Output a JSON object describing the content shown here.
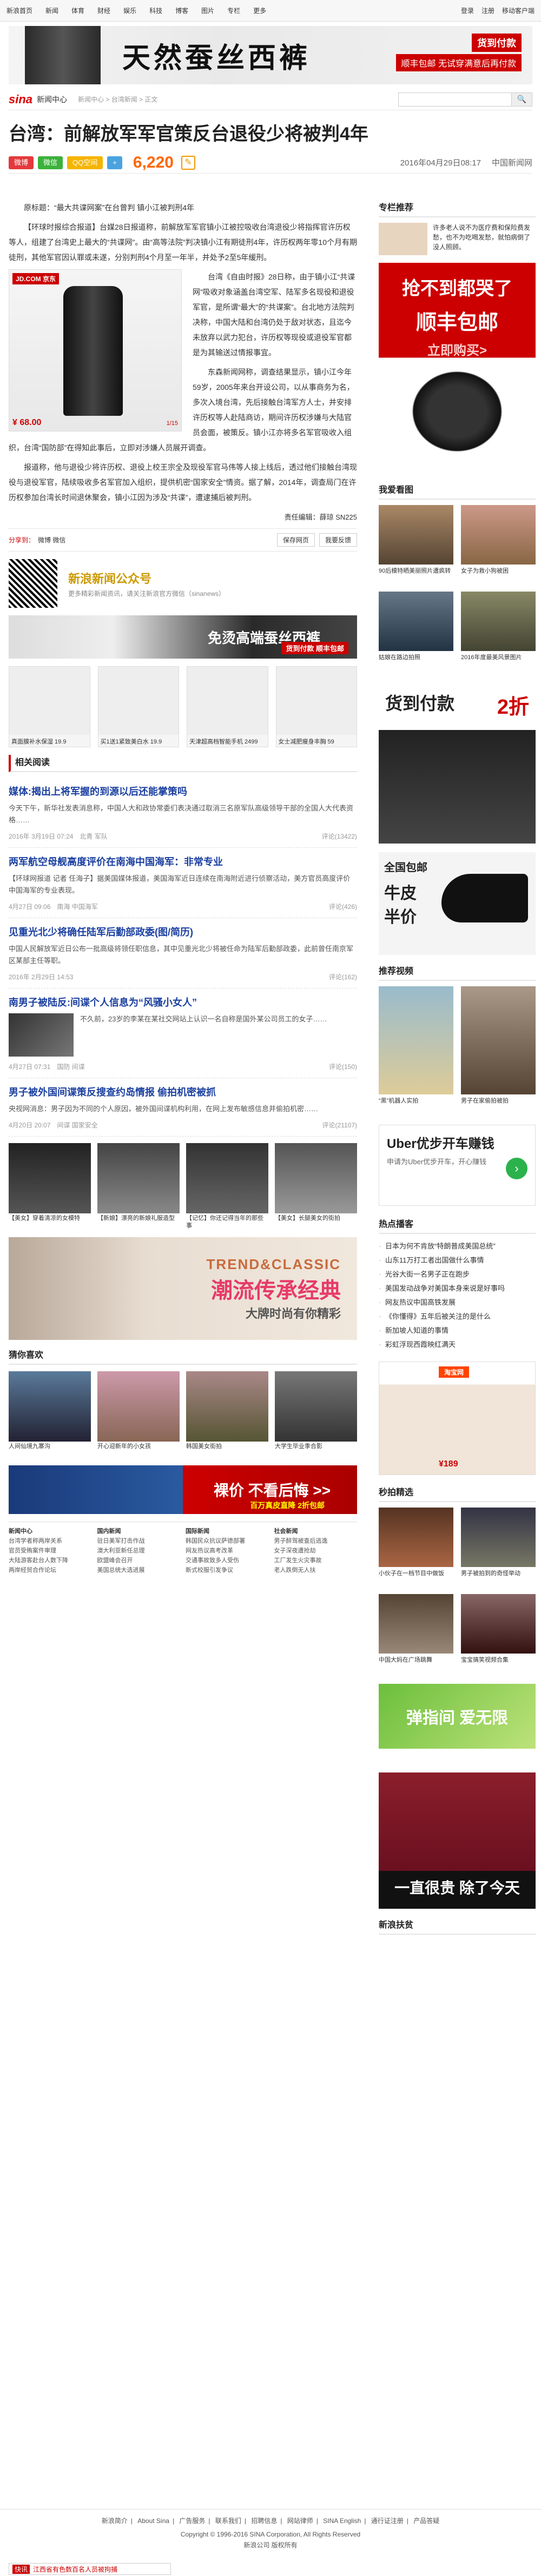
{
  "topnav": {
    "items": [
      "新浪首页",
      "新闻",
      "体育",
      "财经",
      "娱乐",
      "科技",
      "博客",
      "图片",
      "专栏",
      "更多"
    ],
    "right": [
      "登录",
      "注册",
      "移动客户端"
    ]
  },
  "banner_top": {
    "title": "天然蚕丝西裤",
    "tag1": "货到付款",
    "tag2": "顺丰包邮  无试穿满意后再付款"
  },
  "logo": {
    "brand": "sina",
    "name": "新闻中心",
    "crumb": "新闻中心  >  台湾新闻  >  正文"
  },
  "search": {
    "placeholder": "",
    "button": "🔍"
  },
  "headline": "台湾：前解放军军官策反台退役少将被判4年",
  "meta": {
    "share_weibo": "微博",
    "share_wechat": "微信",
    "share_qzone": "QQ空间",
    "share_more": "+",
    "comment_count": "6,220",
    "comment_suffix": "评论",
    "date": "2016年04月29日08:17",
    "source": "中国新闻网"
  },
  "article": {
    "lead": "原标题：“最大共谍网案”在台曾判 镇小江被判刑4年",
    "p1": "【环球时报综合报道】台媒28日报道称，前解放军军官镇小江被控吸收台湾退役少将指挥官许历权等人，组建了台湾史上最大的“共谍网”。由“高等法院”判决镇小江有期徒刑4年，许历权两年零10个月有期徒刑，其他军官因认罪或未遂，分别判刑4个月至一年半，并处予2至5年缓刑。",
    "p2": "台湾《自由时报》28日称，由于镇小江“共谍网”吸收对象涵盖台湾空军、陆军多名现役和退役军官，是所谓“最大”的“共谍案”。台北地方法院判决称，中国大陆和台湾仍处于敌对状态，且迄今未放弃以武力犯台，许历权等现役或退役军官都是为其输送过情报事宜。",
    "p3": "东森新闻网称，调查结果显示，镇小江今年59岁，2005年来台开设公司，以从事商务为名，多次入境台湾，先后接触台湾军方人士，并安排许历权等人赴陆商访，期间许历权涉嫌与大陆官员会面，被策反。镇小江亦将多名军官吸收入组织，台湾“国防部”在得知此事后，立即对涉嫌人员展开调查。",
    "p4": "报道称，他与退役少将许历权、退役上校王宗全及现役军官马伟等人接上线后，透过他们接触台湾现役与退役军官，陆续吸收多名军官加入组织，提供机密“国家安全”情资。据了解，2014年，调查局门在许历权参加台湾长时间退休聚会，镇小江因为涉及“共谍”，遭逮捕后被判刑。",
    "img_tag": "JD.COM 京东",
    "img_price": "¥ 68.00",
    "img_pager": "1/15",
    "editor": "责任编辑：薛琼 SN225"
  },
  "tools": {
    "left": "分享到：",
    "left2": "微博  微信",
    "save": "保存网页",
    "report": "我要反馈"
  },
  "qr": {
    "title": "新浪新闻公众号",
    "sub": "更多精彩新闻资讯，请关注新浪官方微信（sinanews）"
  },
  "ad_mid": {
    "title": "免烫高端蚕丝西裤",
    "sub": "货到付款 顺丰包邮"
  },
  "thumbs": [
    {
      "caption": "真面膜补水保湿 19.9"
    },
    {
      "caption": "买1送1紧致美白水 19.9"
    },
    {
      "caption": "天津超高档智能手机 2499"
    },
    {
      "caption": "女士减肥瘦身丰胸 59"
    }
  ],
  "related": {
    "title": "相关阅读",
    "items": [
      {
        "title": "媒体:揭出上将军握的到源以后还能掌策吗",
        "summary": "今天下午，新华社发表消息称，中国人大和政协常委们表决通过取消三名原军队高级领导干部的全国人大代表资格……",
        "time": "2016年 3月19日 07:24",
        "tag": "北青  军队",
        "comments": "评论(13422)"
      },
      {
        "title": "两军航空母舰高度评价在南海中国海军：非常专业",
        "summary": "【环球网报道 记者 任海子】据美国媒体报道，美国海军近日连续在南海附近进行侦察活动，美方官员高度评价中国海军的专业表现。",
        "time": "4月27日 09:06",
        "tag": "南海  中国海军",
        "comments": "评论(426)"
      },
      {
        "title": "见重光北少将确任陆军后勤部政委(图/简历)",
        "summary": "中国人民解放军近日公布一批高级将领任职信息，其中见重光北少将被任命为陆军后勤部政委，此前曾任南京军区某部主任等职。",
        "time": "2016年 2月29日 14:53",
        "tag": "",
        "comments": "评论(162)"
      },
      {
        "title": "南男子被陆反:间谍个人信息为“风骚小女人”",
        "summary": "不久前，23岁的李某在某社交网站上认识一名自称是国外某公司员工的女子……",
        "time": "4月27日 07:31",
        "tag": "国防  间谍",
        "comments": "评论(150)"
      },
      {
        "title": "男子被外国间谍策反搜查约岛情报 偷拍机密被抓",
        "summary": "央视网消息：男子因为不同的个人原因，被外国间谍机构利用，在网上发布敏感信息并偷拍机密……",
        "time": "4月20日 20:07",
        "tag": "间谍  国家安全",
        "comments": "评论(21107)"
      }
    ]
  },
  "pic_row": [
    {
      "caption": "【美女】穿着清凉的女模特"
    },
    {
      "caption": "【新娘】漂亮的新娘礼服造型"
    },
    {
      "caption": "【记忆】你还记得当年的那些事"
    },
    {
      "caption": "【美女】长腿美女的街拍"
    }
  ],
  "ad_big": {
    "line1": "TREND&CLASSIC",
    "line2": "潮流传承经典",
    "line3": "大牌时尚有你精彩"
  },
  "hot_pics": {
    "title": "猜你喜欢",
    "items": [
      {
        "caption": "人间仙境九寨沟"
      },
      {
        "caption": "开心迎新年的小女孩"
      },
      {
        "caption": "韩国美女街拍"
      },
      {
        "caption": "大学生毕业季合影"
      }
    ]
  },
  "ad_bottom": {
    "title": "裸价  不看后悔 >>",
    "sub": "百万真皮直降  2折包邮"
  },
  "grid_links": {
    "titles": [
      "新闻中心",
      "国内新闻",
      "国际新闻",
      "社会新闻"
    ],
    "rows": [
      [
        "台湾学者称两岸关系",
        "驻日美军打击作战",
        "韩国民众抗议萨德部署",
        "男子醉驾被查后逃逸"
      ],
      [
        "官员受贿案件审理",
        "澳大利亚新任总理",
        "网友热议高考改革",
        "女子深夜遭抢劫"
      ],
      [
        "大陆游客赴台人数下降",
        "欧盟峰会召开",
        "交通事故致多人受伤",
        "工厂发生火灾事故"
      ],
      [
        "两岸经贸合作论坛",
        "美国总统大选进展",
        "新式校服引发争议",
        "老人跌倒无人扶"
      ]
    ]
  },
  "side": {
    "recommend_title": "专栏推荐",
    "recommend_text": "许多老人说不为医疗费和保险费发愁，也不为吃喝发愁，就怕病倒了没人照顾。",
    "ad1": {
      "line1": "抢不到都哭了",
      "line2": "顺丰包邮",
      "line3": "立即购买>"
    },
    "photo_title": "我爱看图",
    "photos": [
      {
        "caption": "90后模特晒美丽照片遭疯转"
      },
      {
        "caption": "女子为救小狗被困"
      },
      {
        "caption": "姑娘在路边拍照"
      },
      {
        "caption": "2016年度最美风景图片"
      }
    ],
    "ad2": {
      "line1": "货到付款",
      "line2": "2折"
    },
    "ad3": {
      "line1": "全国包邮",
      "line2": "牛皮",
      "line3": "半价"
    },
    "video_title": "推荐视频",
    "videos": [
      {
        "caption": "“黑”机器人实拍"
      },
      {
        "caption": "男子在家偷拍被拍"
      }
    ],
    "uber": {
      "title": "Uber优步开车赚钱",
      "sub": "申请为Uber优步开车，开心赚钱"
    },
    "hot_title": "热点播客",
    "hot_list": [
      "日本为何不肯放“特朗普成美国总统”",
      "山东11万打工者出国做什么事情",
      "光谷大街一名男子正在跑步",
      "美国发动战争对美国本身来说是好事吗",
      "网友热议中国高铁发展",
      "《你懂得》五年后被关注的是什么",
      "新加坡人知道的事情",
      "彩虹浮现西霞映红满天"
    ],
    "taobao": {
      "title": "淘宝网",
      "price": "¥189"
    },
    "trend_title": "秒拍精选",
    "trend": [
      {
        "caption": "小伙子在一档节目中做饭"
      },
      {
        "caption": "男子被拍到的奇怪举动"
      },
      {
        "caption": "中国大妈在广场跳舞"
      },
      {
        "caption": "宝宝搞笑视频合集"
      }
    ],
    "ad4": {
      "line1": "弹指间 爱无限",
      "line2": "一直很贵 除了今天"
    },
    "news_title": "新浪扶贫"
  },
  "footer": {
    "links": [
      "新浪简介",
      "About Sina",
      "广告服务",
      "联系我们",
      "招聘信息",
      "网站律师",
      "SINA English",
      "通行证注册",
      "产品答疑"
    ],
    "copyright": "Copyright © 1996-2016 SINA Corporation, All Rights Reserved",
    "sub": "新浪公司 版权所有"
  },
  "floatbar": {
    "label": "快讯",
    "text": "江西省有色数百名人员被拘捕"
  }
}
